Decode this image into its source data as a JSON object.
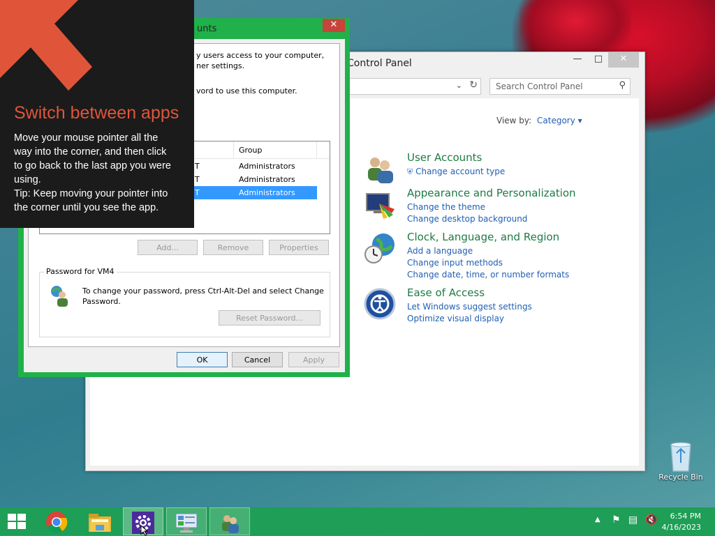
{
  "control_panel": {
    "title": "Control Panel",
    "search_placeholder": "Search Control Panel",
    "view_by_label": "View by:",
    "view_by_value": "Category",
    "categories": [
      {
        "title": "User Accounts",
        "links": [
          "Change account type"
        ]
      },
      {
        "title": "Appearance and Personalization",
        "links": [
          "Change the theme",
          "Change desktop background"
        ]
      },
      {
        "title": "Clock, Language, and Region",
        "links": [
          "Add a language",
          "Change input methods",
          "Change date, time, or number formats"
        ]
      },
      {
        "title": "Ease of Access",
        "links": [
          "Let Windows suggest settings",
          "Optimize visual display"
        ]
      }
    ]
  },
  "user_accounts_dialog": {
    "title": "unts",
    "intro_line1": "y users access to your computer,",
    "intro_line2": "ner settings.",
    "checkbox_text": "vord to use this computer.",
    "list_header_group": "Group",
    "rows": [
      {
        "user": "T",
        "group": "Administrators",
        "selected": false
      },
      {
        "user": "T",
        "group": "Administrators",
        "selected": false
      },
      {
        "user": "T",
        "group": "Administrators",
        "selected": true
      }
    ],
    "add_button": "Add...",
    "remove_button": "Remove",
    "properties_button": "Properties",
    "password_group_label": "Password for VM4",
    "password_text_line1": "To change your password, press Ctrl-Alt-Del and select Change",
    "password_text_line2": "Password.",
    "reset_password_button": "Reset Password...",
    "ok_button": "OK",
    "cancel_button": "Cancel",
    "apply_button": "Apply"
  },
  "tip": {
    "title": "Switch between apps",
    "body_line1": "Move your mouse pointer all the",
    "body_line2": "way into the corner, and then click",
    "body_line3": "to go back to the last app you were",
    "body_line4": "using.",
    "body_line5": "Tip: Keep moving your pointer into",
    "body_line6": "the corner until you see the app."
  },
  "desktop": {
    "recycle_bin_label": "Recycle Bin"
  },
  "taskbar": {
    "time": "6:54 PM",
    "date": "4/16/2023",
    "apps": [
      "start-icon",
      "chrome-icon",
      "file-explorer-icon",
      "settings-icon",
      "control-panel-icon",
      "user-accounts-icon"
    ]
  }
}
